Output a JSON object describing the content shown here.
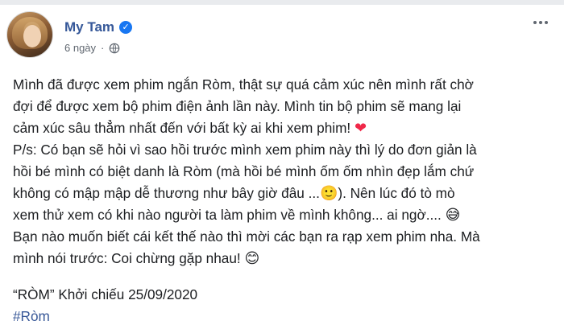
{
  "author": {
    "name": "My Tam",
    "time": "6 ngày",
    "separator": "·"
  },
  "icons": {
    "verified": "verified-badge-icon",
    "privacy": "globe-icon",
    "more": "more-options-icon"
  },
  "post": {
    "lines": [
      "Mình đã được xem phim ngắn Ròm, thật sự quá cảm xúc nên mình rất chờ",
      "đợi để được xem bộ phim điện ảnh lần này. Mình tin bộ phim sẽ mang lại",
      "cảm xúc sâu thẳm nhất đến với bất kỳ ai khi xem phim!",
      "P/s: Có bạn sẽ hỏi vì sao hồi trước mình xem phim này thì lý do đơn giản là",
      "hồi bé mình có biệt danh là Ròm (mà hồi bé mình ốm ốm nhìn đẹp lắm chứ",
      "không có mập mập dễ thương như bây giờ đâu ...",
      "). Nên lúc đó tò mò",
      "xem thử xem có khi nào người ta làm phim về mình không... ai ngờ....",
      "Bạn nào muốn biết cái kết thế nào thì mời các bạn ra rạp xem phim nha. Mà",
      "mình nói trước: Coi chừng gặp nhau!"
    ],
    "emojis": {
      "heart": "❤",
      "smile": "🙂",
      "grin_sweat": "😅",
      "blush": "😊"
    },
    "release": "“RÒM” Khởi chiếu 25/09/2020",
    "hashtag": "#Ròm"
  }
}
